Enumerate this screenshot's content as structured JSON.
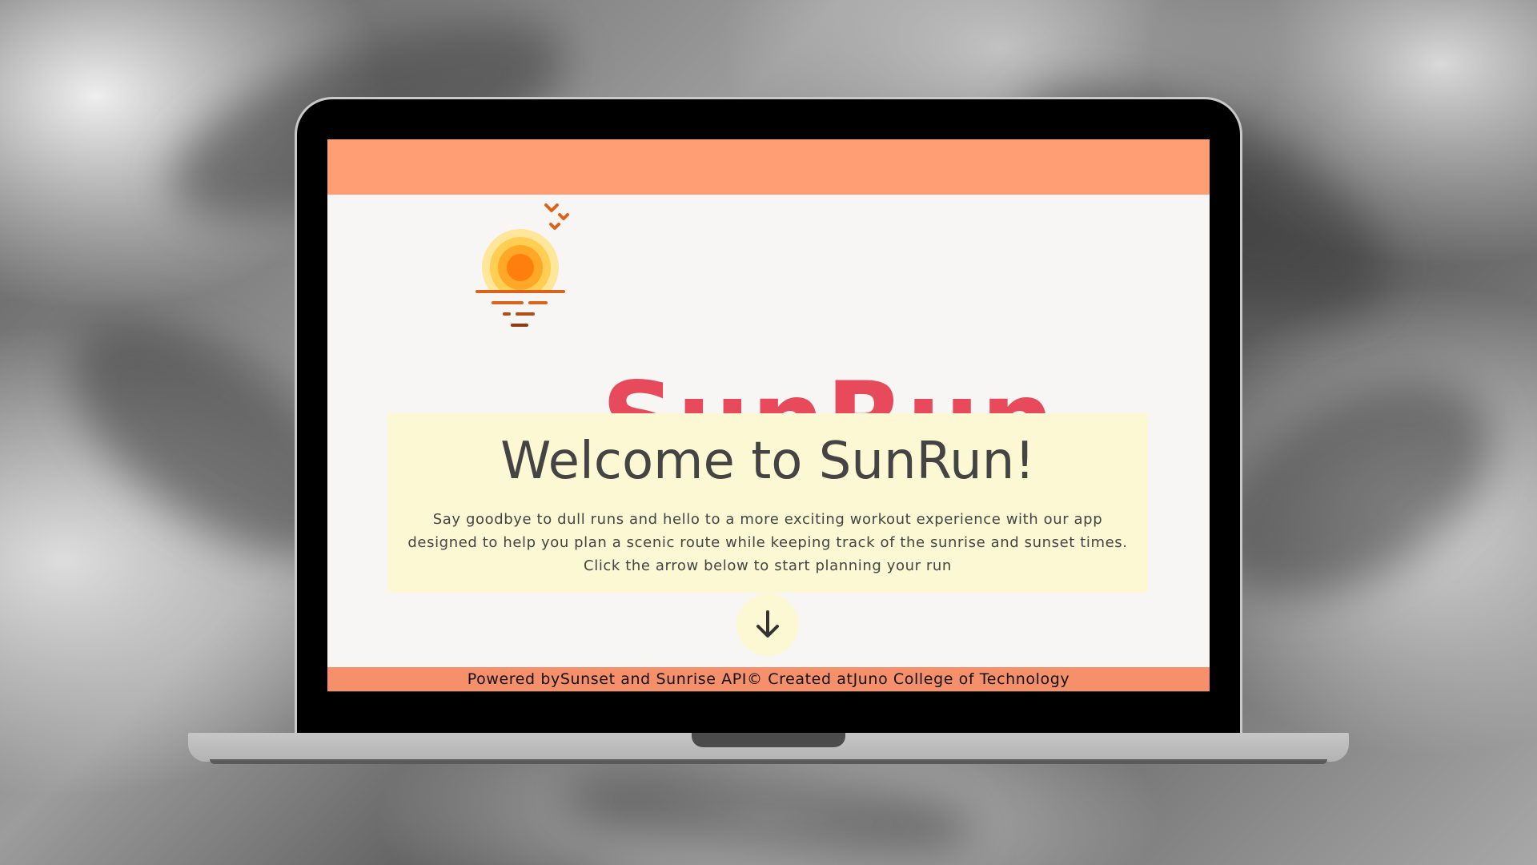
{
  "app": {
    "title": "SunRun"
  },
  "welcome": {
    "heading": "Welcome to SunRun!",
    "body_line1": "Say goodbye to dull runs and hello to a more exciting workout experience with our app",
    "body_line2": "designed to help you plan a scenic route while keeping track of the sunrise and sunset times.",
    "body_line3": "Click the arrow below to start planning your run"
  },
  "footer": {
    "powered_prefix": "Powered by",
    "powered_link": "Sunset and Sunrise API",
    "created_prefix": "© Created at",
    "created_link": "Juno College of Technology"
  },
  "icons": {
    "logo": "sunset-logo-icon",
    "arrow": "arrow-down-icon"
  },
  "colors": {
    "header_bar": "#ff9e74",
    "footer_bar": "#f5906a",
    "title": "#e64a5b",
    "welcome_bg": "#fbf8d3",
    "text": "#444444",
    "page_bg": "#f7f6f4"
  }
}
